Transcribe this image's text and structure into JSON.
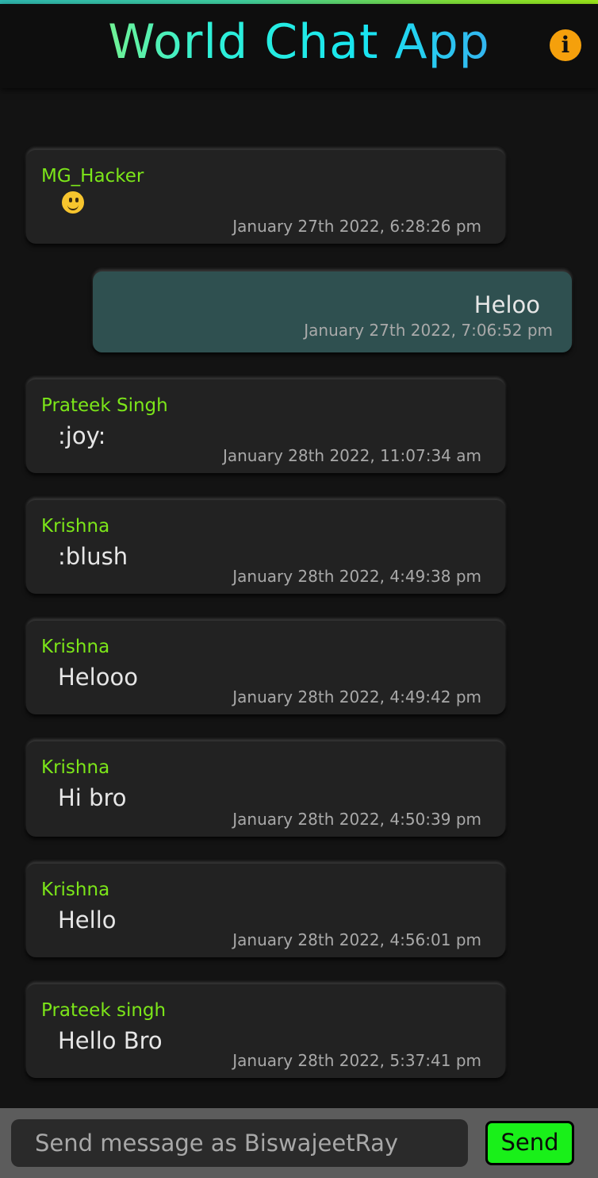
{
  "header": {
    "title": "World Chat App",
    "info_icon": "info-circle-icon",
    "info_glyph": "i"
  },
  "messages": [
    {
      "sender": "MG_Hacker",
      "text": "🙂",
      "time": "January 27th 2022, 6:28:26 pm",
      "own": false,
      "emoji": "slightly-smiling-face-icon"
    },
    {
      "sender": "",
      "text": "Heloo",
      "time": "January 27th 2022, 7:06:52 pm",
      "own": true
    },
    {
      "sender": "Prateek Singh",
      "text": ":joy:",
      "time": "January 28th 2022, 11:07:34 am",
      "own": false
    },
    {
      "sender": "Krishna",
      "text": ":blush",
      "time": "January 28th 2022, 4:49:38 pm",
      "own": false
    },
    {
      "sender": "Krishna",
      "text": "Helooo",
      "time": "January 28th 2022, 4:49:42 pm",
      "own": false
    },
    {
      "sender": "Krishna",
      "text": "Hi bro",
      "time": "January 28th 2022, 4:50:39 pm",
      "own": false
    },
    {
      "sender": "Krishna",
      "text": "Hello",
      "time": "January 28th 2022, 4:56:01 pm",
      "own": false
    },
    {
      "sender": "Prateek singh",
      "text": "Hello Bro",
      "time": "January 28th 2022, 5:37:41 pm",
      "own": false
    }
  ],
  "composer": {
    "placeholder": "Send message as BiswajeetRay",
    "value": "",
    "send_label": "Send"
  },
  "colors": {
    "accent": "#7ce619",
    "own_bubble": "#2f5050",
    "bubble": "#222222",
    "send_button": "#19f019",
    "info_icon": "#f5a00c"
  }
}
